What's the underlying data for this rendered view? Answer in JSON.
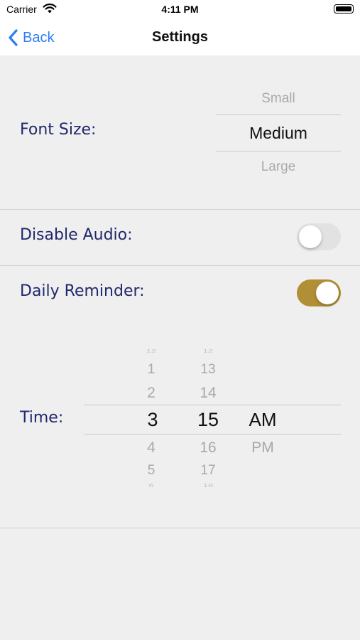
{
  "status_bar": {
    "carrier": "Carrier",
    "time": "4:11 PM"
  },
  "nav": {
    "back_label": "Back",
    "title": "Settings"
  },
  "font_size": {
    "label": "Font Size:",
    "options": [
      "Small",
      "Medium",
      "Large"
    ],
    "selected": "Medium"
  },
  "disable_audio": {
    "label": "Disable Audio:",
    "enabled": false
  },
  "daily_reminder": {
    "label": "Daily Reminder:",
    "enabled": true,
    "accent_color": "#b18f36"
  },
  "time": {
    "label": "Time:",
    "hour_wheel": [
      "12",
      "1",
      "2",
      "3",
      "4",
      "5",
      "6"
    ],
    "minute_wheel": [
      "12",
      "13",
      "14",
      "15",
      "16",
      "17",
      "18"
    ],
    "period_wheel": [
      "AM",
      "PM"
    ],
    "selected_hour": "3",
    "selected_minute": "15",
    "selected_period": "AM"
  },
  "colors": {
    "label_text": "#20286b",
    "link_blue": "#2f7cf6",
    "background": "#efefef"
  }
}
